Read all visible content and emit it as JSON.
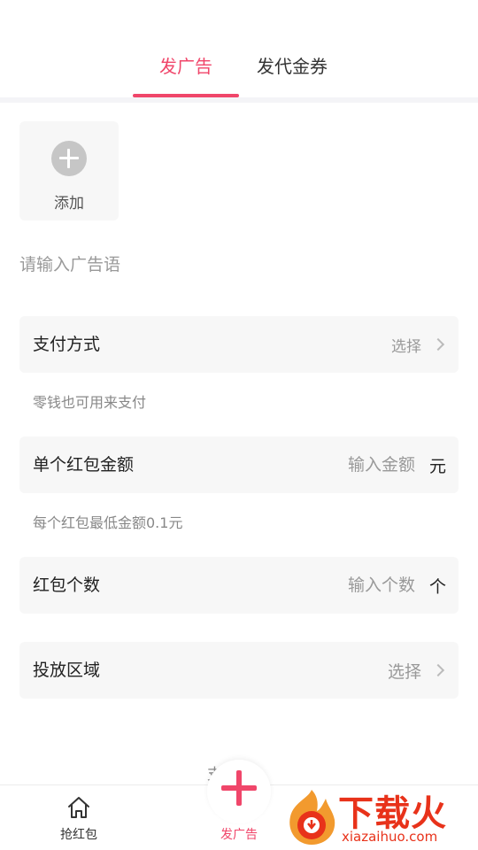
{
  "tabs": [
    {
      "label": "发广告",
      "active": true
    },
    {
      "label": "发代金券",
      "active": false
    }
  ],
  "add_image": {
    "label": "添加"
  },
  "ad_text": {
    "placeholder": "请输入广告语",
    "value": ""
  },
  "payment": {
    "label": "支付方式",
    "value": "选择",
    "hint": "零钱也可用来支付"
  },
  "amount": {
    "label": "单个红包金额",
    "placeholder": "输入金额",
    "unit": "元",
    "hint": "每个红包最低金额0.1元"
  },
  "count": {
    "label": "红包个数",
    "placeholder": "输入个数",
    "unit": "个"
  },
  "region": {
    "label": "投放区域",
    "value": "选择"
  },
  "overlap_text": "支   题",
  "bottom_nav": {
    "home_label": "抢红包",
    "post_label": "发广告"
  },
  "watermark": {
    "brand": "下载火",
    "url": "xiazaihuo.com"
  },
  "colors": {
    "accent": "#f0466a",
    "watermark": "#e8321a"
  }
}
